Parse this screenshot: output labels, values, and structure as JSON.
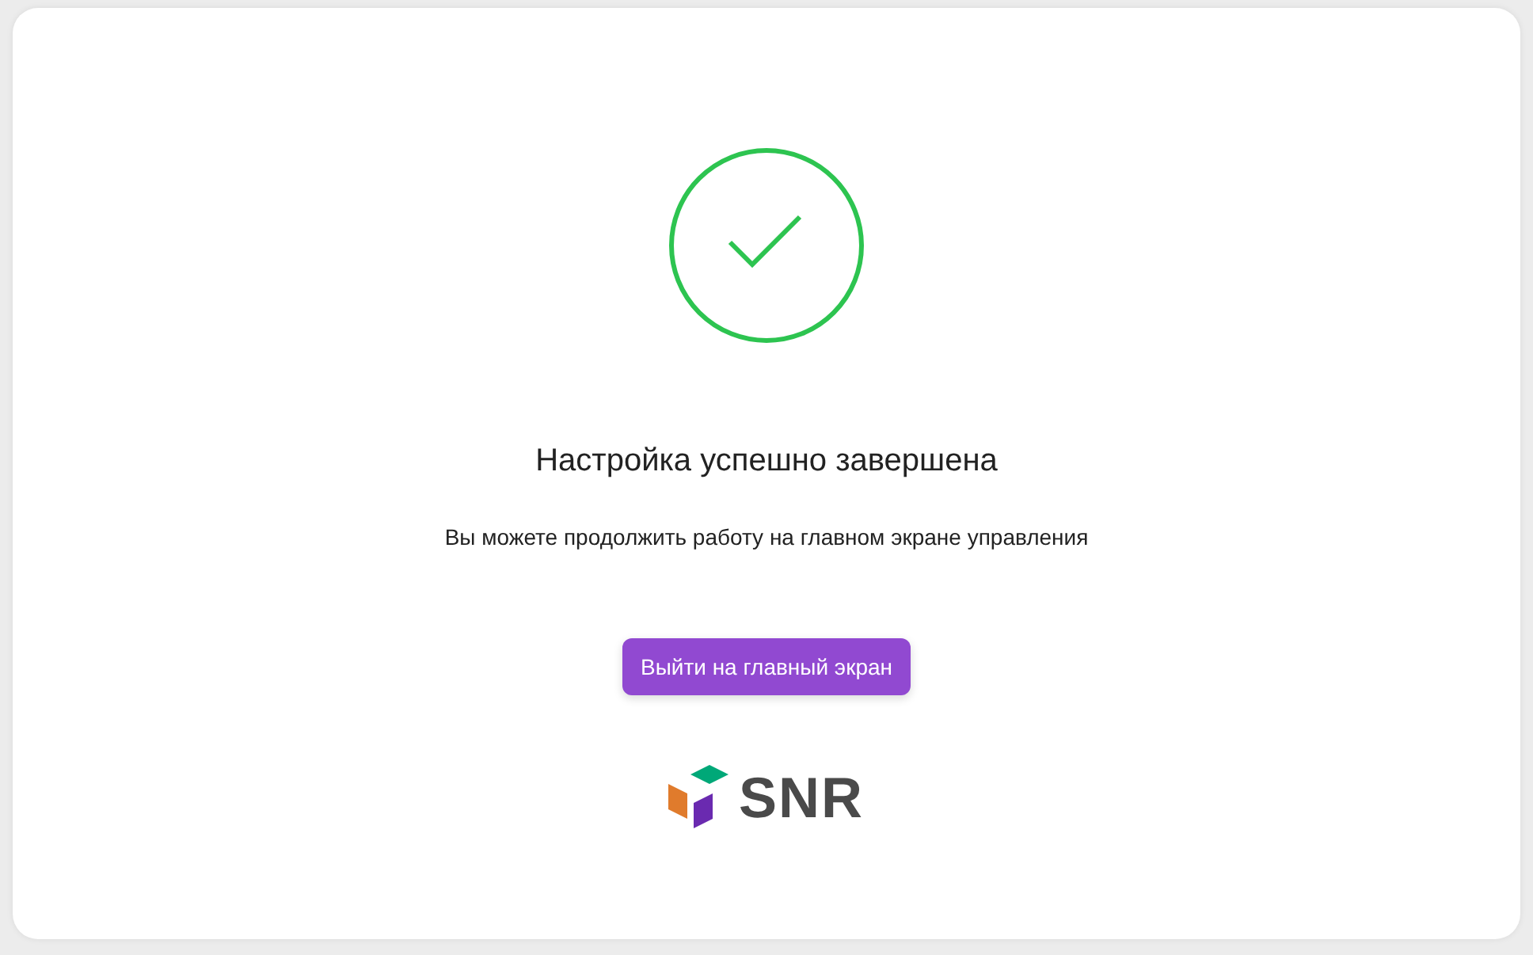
{
  "title": "Настройка успешно завершена",
  "message": "Вы можете продолжить работу на главном экране управления",
  "button": {
    "label": "Выйти на главный экран"
  },
  "logo": {
    "text": "SNR"
  }
}
